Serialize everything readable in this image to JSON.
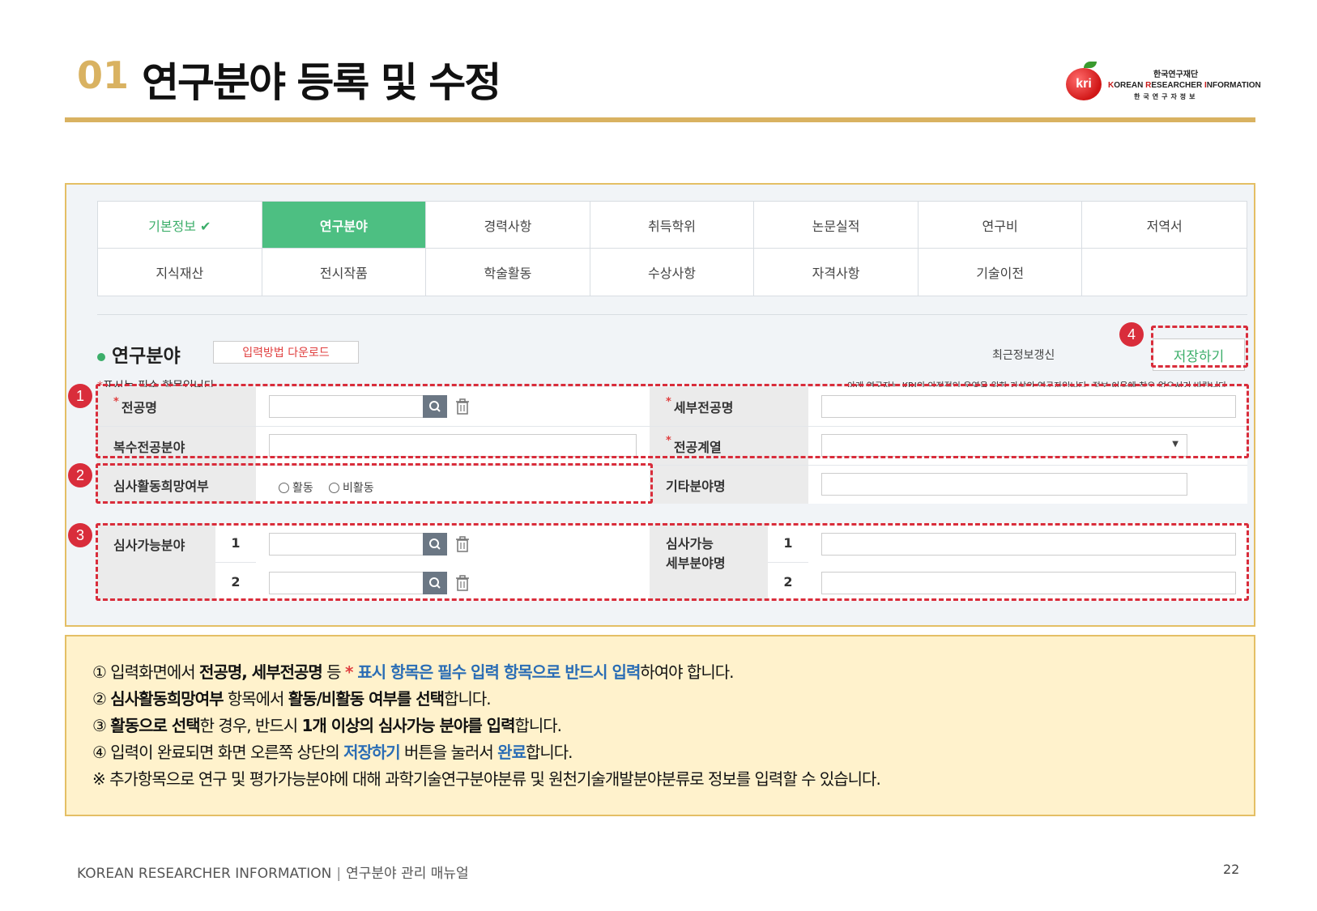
{
  "header": {
    "number": "01",
    "title": "연구분야 등록 및 수정",
    "logo": {
      "org_name": "한국연구재단",
      "mark": "kri",
      "english_parts": [
        {
          "cap": "K",
          "rest": "OREAN "
        },
        {
          "cap": "R",
          "rest": "ESEARCHER "
        },
        {
          "cap": "I",
          "rest": "NFORMATION"
        }
      ],
      "korean": "한국연구자정보"
    }
  },
  "tabs": [
    {
      "label": "기본정보 ✔",
      "state": "done"
    },
    {
      "label": "연구분야",
      "state": "active"
    },
    {
      "label": "경력사항",
      "state": ""
    },
    {
      "label": "취득학위",
      "state": ""
    },
    {
      "label": "논문실적",
      "state": ""
    },
    {
      "label": "연구비",
      "state": ""
    },
    {
      "label": "저역서",
      "state": ""
    },
    {
      "label": "지식재산",
      "state": ""
    },
    {
      "label": "전시작품",
      "state": ""
    },
    {
      "label": "학술활동",
      "state": ""
    },
    {
      "label": "수상사항",
      "state": ""
    },
    {
      "label": "자격사항",
      "state": ""
    },
    {
      "label": "기술이전",
      "state": ""
    },
    {
      "label": "",
      "state": ""
    }
  ],
  "section": {
    "title": "연구분야",
    "download_button": "입력방법 다운로드",
    "recent_update": "최근정보갱신",
    "save_button": "저장하기",
    "required_star": "*",
    "required_note": "표시는 필수 항목입니다.",
    "info_note": "아래 연구자는 KRI의 안정적인 운영을 위한 가상의 연구자입니다. 정보 이용에 착오 없으시기 바랍니다"
  },
  "form": {
    "major_label": "전공명",
    "major_value": "",
    "sub_major_label": "세부전공명",
    "sub_major_value": "",
    "double_major_label": "복수전공분야",
    "double_major_value": "",
    "major_series_label": "전공계열",
    "major_series_value": "",
    "review_wish_label": "심사활동희망여부",
    "radio_active": "활동",
    "radio_inactive": "비활동",
    "other_field_label": "기타분야명",
    "other_field_value": "",
    "review_field_label": "심사가능분야",
    "review_field_name_label_1": "심사가능",
    "review_field_name_label_2": "세부분야명",
    "row_1": "1",
    "row_2": "2"
  },
  "badges": [
    "1",
    "2",
    "3",
    "4"
  ],
  "notes": [
    {
      "parts": [
        {
          "t": "① 입력화면에서 "
        },
        {
          "t": "전공명, 세부전공명",
          "s": "b"
        },
        {
          "t": " 등 "
        },
        {
          "t": "*",
          "s": "star"
        },
        {
          "t": " 표시 항목은 필수 입력 항목으로 반드시 입력",
          "s": "hl"
        },
        {
          "t": "하여야 합니다."
        }
      ]
    },
    {
      "parts": [
        {
          "t": "② "
        },
        {
          "t": "심사활동희망여부",
          "s": "b"
        },
        {
          "t": " 항목에서 "
        },
        {
          "t": "활동/비활동 여부를 선택",
          "s": "b"
        },
        {
          "t": "합니다."
        }
      ]
    },
    {
      "parts": [
        {
          "t": "③ "
        },
        {
          "t": "활동으로 선택",
          "s": "b"
        },
        {
          "t": "한 경우, 반드시 "
        },
        {
          "t": "1개 이상의 심사가능 분야를 입력",
          "s": "b"
        },
        {
          "t": "합니다."
        }
      ]
    },
    {
      "parts": [
        {
          "t": "④ 입력이 완료되면 화면 오른쪽 상단의 "
        },
        {
          "t": "저장하기",
          "s": "hl"
        },
        {
          "t": " 버튼을 눌러서 "
        },
        {
          "t": "완료",
          "s": "hl"
        },
        {
          "t": "합니다."
        }
      ]
    },
    {
      "parts": [
        {
          "t": "※ 추가항목으로 연구 및 평가가능분야에 대해 과학기술연구분야분류 및 원천기술개발분야분류로 정보를 입력할 수 있습니다."
        }
      ]
    }
  ],
  "footer": {
    "brand": "KOREAN RESEARCHER INFORMATION",
    "divider": "|",
    "manual": "연구분야 관리 매뉴얼",
    "page": "22"
  },
  "colors": {
    "gold": "#d9b261",
    "active_tab": "#4dbf82",
    "dashed_highlight": "#d92d3b",
    "note_bg": "#fff2cc"
  }
}
